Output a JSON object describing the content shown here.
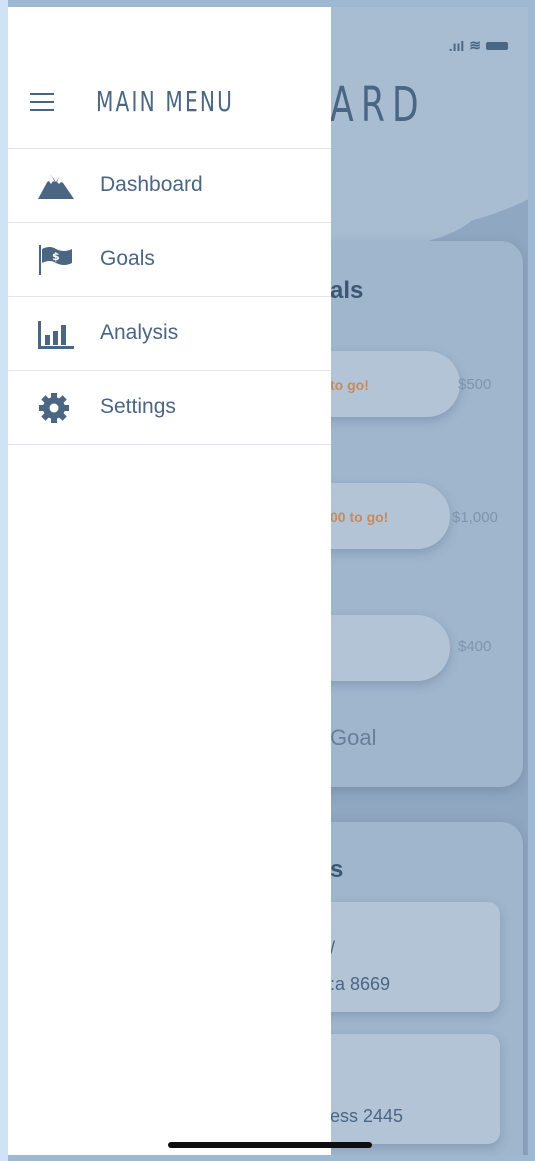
{
  "status_bar": {
    "signal": ".ııl",
    "wifi": "≋"
  },
  "background_app": {
    "title": "ARD",
    "goals_card": {
      "title": "als",
      "goals": [
        {
          "progress_text": "to go!",
          "amount": "$500"
        },
        {
          "progress_text": "00 to go!",
          "amount": "$1,000"
        },
        {
          "progress_text": "",
          "amount": "$400"
        }
      ],
      "add_goal": "Goal"
    },
    "accounts_card": {
      "title": "s",
      "accounts": [
        {
          "line1": "/",
          "line2": ":a 8669"
        },
        {
          "line1": "",
          "line2": "ess 2445"
        }
      ]
    }
  },
  "drawer": {
    "title": "MAIN MENU",
    "items": [
      {
        "label": "Dashboard",
        "icon": "mountain-icon"
      },
      {
        "label": "Goals",
        "icon": "flag-icon"
      },
      {
        "label": "Analysis",
        "icon": "bar-chart-icon"
      },
      {
        "label": "Settings",
        "icon": "gear-icon"
      }
    ]
  },
  "colors": {
    "accent": "#4b6683",
    "drawer_bg": "#ffffff",
    "overlay": "#8fa7c0",
    "highlight": "#c88a5a"
  }
}
